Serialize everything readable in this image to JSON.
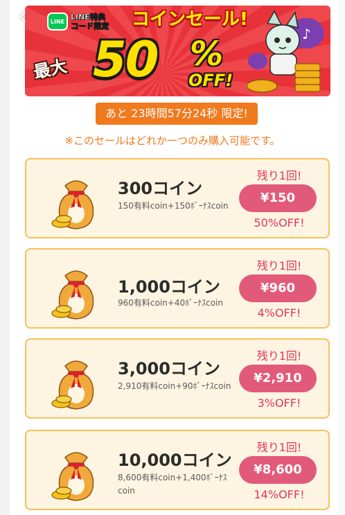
{
  "navigation": {
    "back_icon": "chevron-left-icon"
  },
  "banner": {
    "line_logo_text": "LINE",
    "line_special_line1": "LINE特典",
    "line_special_line2": "コード限定",
    "title": "コインセール!",
    "max_label": "最大",
    "percent": "50",
    "percent_sign": "%",
    "off_label": "OFF!"
  },
  "timer": {
    "text": "あと 23時間57分24秒 限定!"
  },
  "notice": {
    "text": "※このセールはどれか一つのみ購入可能です。"
  },
  "colors": {
    "accent_orange": "#f07a1e",
    "price_pink": "#e25a7a",
    "card_bg": "#fef4e2",
    "card_border": "#f6c05a",
    "banner_red": "#e8323a"
  },
  "packages": [
    {
      "title": "300コイン",
      "desc": "150有料coin+150ﾎﾞｰﾅｽcoin",
      "remaining": "残り1回!",
      "price": "¥150",
      "discount": "50%OFF!"
    },
    {
      "title": "1,000コイン",
      "desc": "960有料coin+40ﾎﾞｰﾅｽcoin",
      "remaining": "残り1回!",
      "price": "¥960",
      "discount": "4%OFF!"
    },
    {
      "title": "3,000コイン",
      "desc": "2,910有料coin+90ﾎﾞｰﾅｽcoin",
      "remaining": "残り1回!",
      "price": "¥2,910",
      "discount": "3%OFF!"
    },
    {
      "title": "10,000コイン",
      "desc": "8,600有料coin+1,400ﾎﾞｰﾅｽcoin",
      "remaining": "残り1回!",
      "price": "¥8,600",
      "discount": "14%OFF!"
    }
  ]
}
